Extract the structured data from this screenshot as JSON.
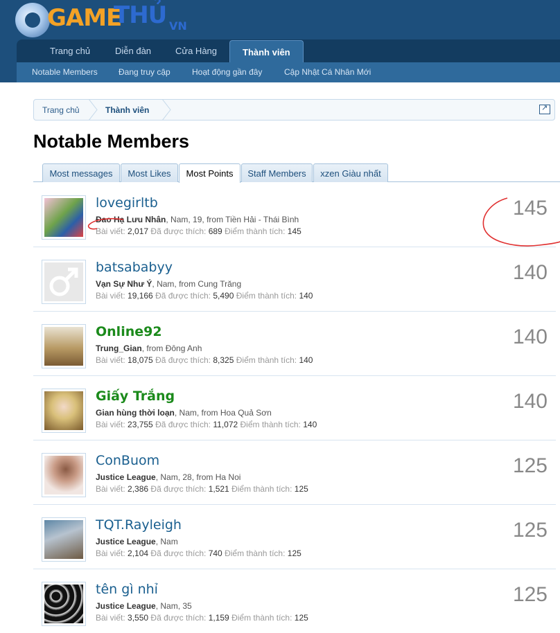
{
  "logo": {
    "part1": "GAME",
    "part2": "THỦ",
    "part3": "VN"
  },
  "nav": {
    "tabs": [
      "Trang chủ",
      "Diễn đàn",
      "Cửa Hàng",
      "Thành viên"
    ],
    "sub": [
      "Notable Members",
      "Đang truy cập",
      "Hoạt động gần đây",
      "Cập Nhật Cá Nhân Mới"
    ]
  },
  "breadcrumb": [
    "Trang chủ",
    "Thành viên"
  ],
  "page_title": "Notable Members",
  "tabs": [
    "Most messages",
    "Most Likes",
    "Most Points",
    "Staff Members",
    "xzen Giàu nhất"
  ],
  "labels": {
    "posts": "Bài viết:",
    "likes": "Đã được thích:",
    "points": "Điểm thành tích:"
  },
  "members": [
    {
      "name": "lovegirltb",
      "title": "Đao Hạ Lưu Nhân",
      "meta": ", Nam, 19, from Tiền Hải - Thái Bình",
      "posts": "2,017",
      "likes": "689",
      "points": "145",
      "score": "145",
      "green": false
    },
    {
      "name": "batsababyy",
      "title": "Vạn Sự Như Ý",
      "meta": ", Nam, from Cung Trăng",
      "posts": "19,166",
      "likes": "5,490",
      "points": "140",
      "score": "140",
      "green": false
    },
    {
      "name": "Online92",
      "title": "Trung_Gian",
      "meta": ", from Đông Anh",
      "posts": "18,075",
      "likes": "8,325",
      "points": "140",
      "score": "140",
      "green": true
    },
    {
      "name": "Giấy Trắng",
      "title": "Gian hùng thời loạn",
      "meta": ", Nam, from Hoa Quả Sơn",
      "posts": "23,755",
      "likes": "11,072",
      "points": "140",
      "score": "140",
      "green": true
    },
    {
      "name": "ConBuom",
      "title": "Justice League",
      "meta": ", Nam, 28, from Ha Noi",
      "posts": "2,386",
      "likes": "1,521",
      "points": "125",
      "score": "125",
      "green": false
    },
    {
      "name": "TQT.Rayleigh",
      "title": "Justice League",
      "meta": ", Nam",
      "posts": "2,104",
      "likes": "740",
      "points": "125",
      "score": "125",
      "green": false
    },
    {
      "name": "tên gì nhỉ",
      "title": "Justice League",
      "meta": ", Nam, 35",
      "posts": "3,550",
      "likes": "1,159",
      "points": "125",
      "score": "125",
      "green": false
    }
  ]
}
